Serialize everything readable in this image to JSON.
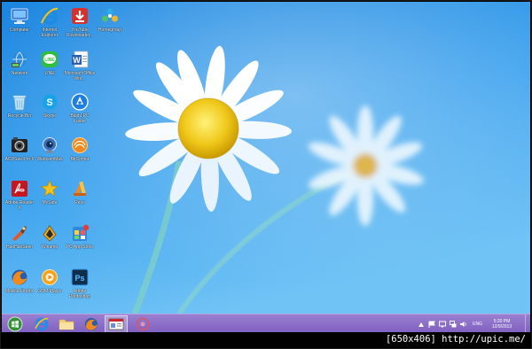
{
  "desktop": {
    "icons": [
      {
        "label": "Computer",
        "icon": "computer-icon"
      },
      {
        "label": "Internet Explorer",
        "icon": "ie-icon"
      },
      {
        "label": "YouTube Downloader...",
        "icon": "youtube-downloader-icon"
      },
      {
        "label": "Homegroup",
        "icon": "homegroup-icon"
      },
      {
        "label": "Network",
        "icon": "network-icon"
      },
      {
        "label": "LINE",
        "icon": "line-icon"
      },
      {
        "label": "Microsoft Office Wor...",
        "icon": "word-icon"
      },
      {
        "label": "Recycle Bin",
        "icon": "recycle-bin-icon"
      },
      {
        "label": "Skype",
        "icon": "skype-icon"
      },
      {
        "label": "Baidu PC Faster",
        "icon": "baidu-pc-faster-icon"
      },
      {
        "label": "ACDSee Pro 6",
        "icon": "acdsee-icon"
      },
      {
        "label": "WebcamMax",
        "icon": "webcammax-icon"
      },
      {
        "label": "BitComet",
        "icon": "bitcomet-icon"
      },
      {
        "label": "Adobe Reader X",
        "icon": "adobe-reader-icon"
      },
      {
        "label": "MySafe",
        "icon": "mysafe-icon"
      },
      {
        "label": "Revo",
        "icon": "revo-icon"
      },
      {
        "label": "HaoHaoSeen",
        "icon": "haohaoseen-icon"
      },
      {
        "label": "Winamp",
        "icon": "winamp-icon"
      },
      {
        "label": "PC App Store",
        "icon": "pc-app-store-icon"
      },
      {
        "label": "Mozilla Firefox",
        "icon": "firefox-icon"
      },
      {
        "label": "GOM Player",
        "icon": "gom-player-icon"
      },
      {
        "label": "Adobe Photoshop",
        "icon": "photoshop-icon"
      }
    ]
  },
  "taskbar": {
    "items": [
      {
        "name": "start",
        "icon": "start-orb-icon"
      },
      {
        "name": "internet-explorer",
        "icon": "ie-icon"
      },
      {
        "name": "file-explorer",
        "icon": "folder-icon"
      },
      {
        "name": "firefox",
        "icon": "firefox-icon"
      },
      {
        "name": "active-window",
        "icon": "window-icon"
      },
      {
        "name": "app",
        "icon": "app-icon"
      }
    ],
    "tray": {
      "lang": "ENG",
      "time": "5:20 PM",
      "date": "12/9/2013"
    }
  },
  "watermark": "[650x406] http://upic.me/",
  "colors": {
    "sky_top": "#1f8be0",
    "sky_bottom": "#63b9f3",
    "taskbar": "#8a6cc7"
  }
}
